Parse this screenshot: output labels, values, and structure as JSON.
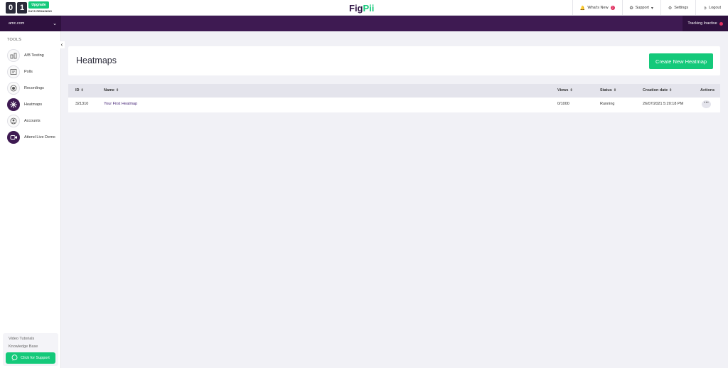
{
  "header": {
    "counter_digits": [
      "0",
      "1"
    ],
    "upgrade_label": "Upgrade",
    "days_label": "DAYS REMAINING",
    "logo_part1": "Fig",
    "logo_part2": "Pii",
    "nav": {
      "whats_new": "What's New",
      "whats_new_badge": "2",
      "support": "Support",
      "settings": "Settings",
      "logout": "Logout"
    }
  },
  "subbar": {
    "site": "amc.com",
    "tracking": "Tracking Inactive"
  },
  "sidebar": {
    "title": "TOOLS",
    "items": [
      {
        "label": "A/B Testing",
        "icon": "ab-testing-icon"
      },
      {
        "label": "Polls",
        "icon": "polls-icon"
      },
      {
        "label": "Recordings",
        "icon": "recordings-icon"
      },
      {
        "label": "Heatmaps",
        "icon": "heatmaps-icon"
      },
      {
        "label": "Accounts",
        "icon": "accounts-icon"
      },
      {
        "label": "Attend Live Demo",
        "icon": "video-icon"
      }
    ],
    "video_tutorials": "Video Tutorials",
    "knowledge_base": "Knowledge Base",
    "support_button": "Click for Support"
  },
  "main": {
    "title": "Heatmaps",
    "create_button": "Create New Heatmap",
    "table": {
      "columns": [
        "ID",
        "Name",
        "Views",
        "Status",
        "Creation date",
        "Actions"
      ],
      "rows": [
        {
          "id": "321310",
          "name": "Your First Heatmap",
          "views": "0/1000",
          "status": "Running",
          "created": "26/07/2021 5:20:18 PM"
        }
      ]
    }
  },
  "colors": {
    "brand_purple": "#3e1a52",
    "accent_green": "#14c97a",
    "alert_red": "#e02f5f"
  }
}
